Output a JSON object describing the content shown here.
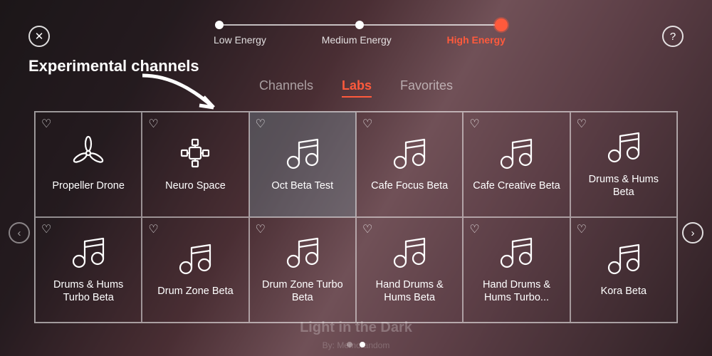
{
  "buttons": {
    "close": "✕",
    "help": "?",
    "prev": "‹",
    "next": "›"
  },
  "slider": {
    "labels": [
      "Low Energy",
      "Medium Energy",
      "High Energy"
    ],
    "selected": 2
  },
  "annotation": "Experimental channels",
  "tabs": [
    {
      "label": "Channels",
      "active": false
    },
    {
      "label": "Labs",
      "active": true
    },
    {
      "label": "Favorites",
      "active": false
    }
  ],
  "cards": [
    {
      "label": "Propeller Drone",
      "icon": "propeller",
      "selected": false
    },
    {
      "label": "Neuro Space",
      "icon": "neuro",
      "selected": false
    },
    {
      "label": "Oct Beta Test",
      "icon": "music",
      "selected": true
    },
    {
      "label": "Cafe Focus Beta",
      "icon": "music",
      "selected": false
    },
    {
      "label": "Cafe Creative Beta",
      "icon": "music",
      "selected": false
    },
    {
      "label": "Drums & Hums Beta",
      "icon": "music",
      "selected": false
    },
    {
      "label": "Drums & Hums Turbo Beta",
      "icon": "music",
      "selected": false
    },
    {
      "label": "Drum Zone Beta",
      "icon": "music",
      "selected": false
    },
    {
      "label": "Drum Zone Turbo Beta",
      "icon": "music",
      "selected": false
    },
    {
      "label": "Hand Drums & Hums Beta",
      "icon": "music",
      "selected": false
    },
    {
      "label": "Hand Drums & Hums Turbo...",
      "icon": "music",
      "selected": false
    },
    {
      "label": "Kora Beta",
      "icon": "music",
      "selected": false
    }
  ],
  "pager": {
    "count": 2,
    "active": 1
  },
  "background_track": {
    "title": "Light in the Dark",
    "byline": "By: Memorandom"
  }
}
